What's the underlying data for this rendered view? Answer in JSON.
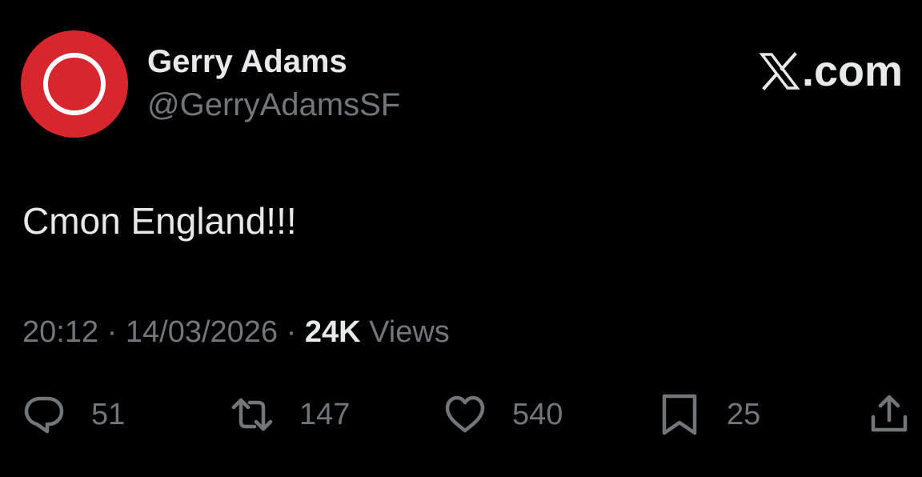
{
  "tweet": {
    "display_name": "Gerry Adams",
    "handle": "@GerryAdamsSF",
    "source": ".com",
    "text": "Cmon England!!!",
    "time": "20:12",
    "date": "14/03/2026",
    "separator": "·",
    "views_count": "24K",
    "views_label": "Views"
  },
  "actions": {
    "replies": "51",
    "reposts": "147",
    "likes": "540",
    "bookmarks": "25"
  },
  "icons": {
    "avatar": "avatar-red-circle-ring",
    "source": "x-logo-icon",
    "reply": "reply-icon",
    "repost": "repost-icon",
    "like": "heart-icon",
    "bookmark": "bookmark-icon",
    "share": "share-icon"
  },
  "colors": {
    "background": "#000000",
    "primary_text": "#e7e9ea",
    "secondary_text": "#71767b",
    "avatar_bg": "#d7262e"
  }
}
